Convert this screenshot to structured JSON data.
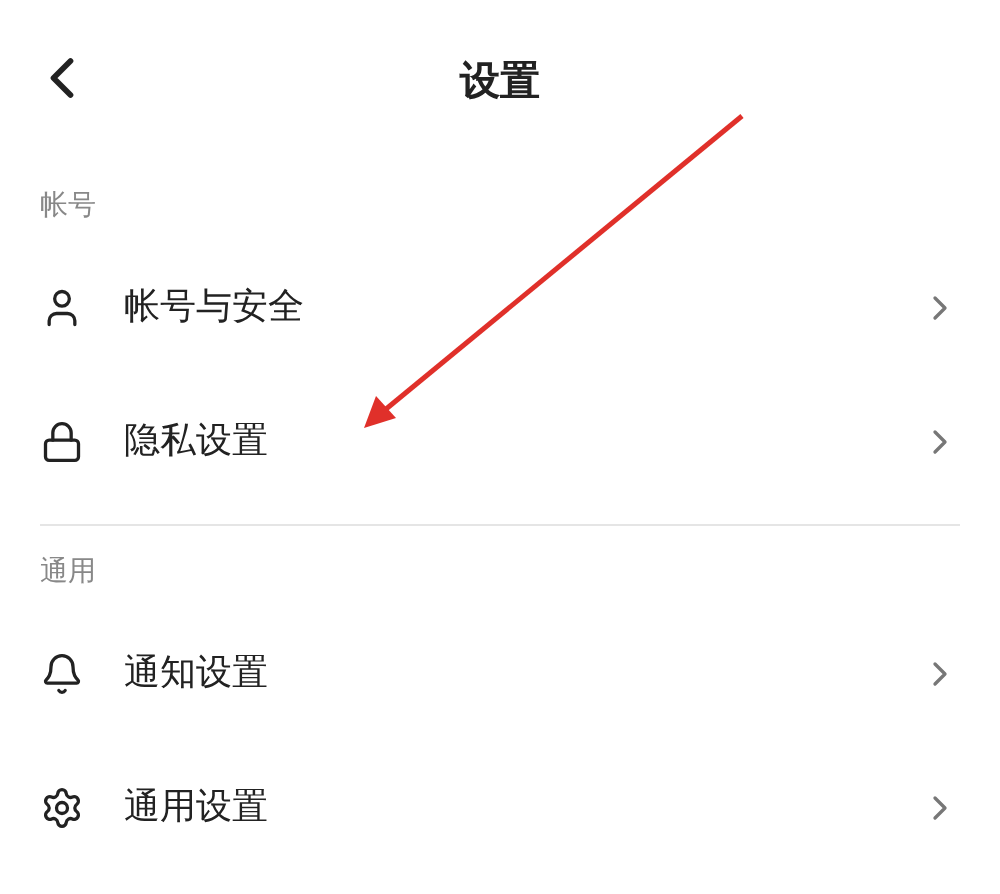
{
  "header": {
    "title": "设置"
  },
  "sections": [
    {
      "label": "帐号",
      "items": [
        {
          "label": "帐号与安全",
          "kind": "user"
        },
        {
          "label": "隐私设置",
          "kind": "lock"
        }
      ]
    },
    {
      "label": "通用",
      "items": [
        {
          "label": "通知设置",
          "kind": "bell"
        },
        {
          "label": "通用设置",
          "kind": "gear"
        }
      ]
    }
  ]
}
